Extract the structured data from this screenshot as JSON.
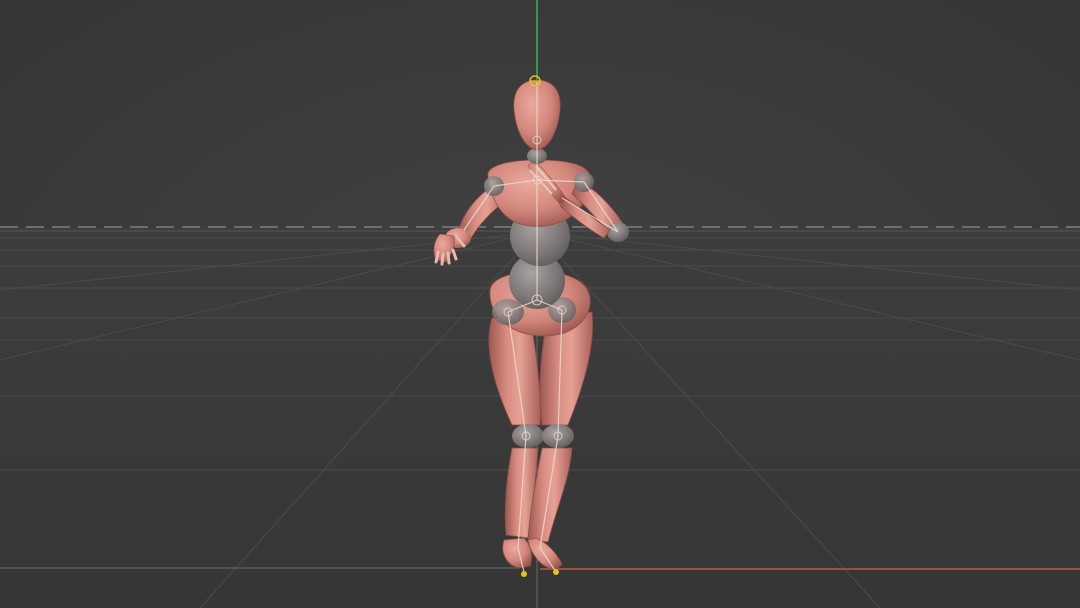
{
  "viewport": {
    "colors": {
      "background": "#3c3c3c",
      "horizon_dashes": "#6e6e6e",
      "grid_lines": "#4a4a4a",
      "y_axis": "#3fae5a",
      "x_axis": "#c4553f",
      "mesh": "#d4857a",
      "mesh_shadow": "#a25e56",
      "joint_spheres": "#8a8584",
      "bones": "#e8d8cf",
      "selected_handle": "#e6c21c"
    },
    "icons": [
      "root-handle-icon",
      "foot-control-icon"
    ]
  }
}
